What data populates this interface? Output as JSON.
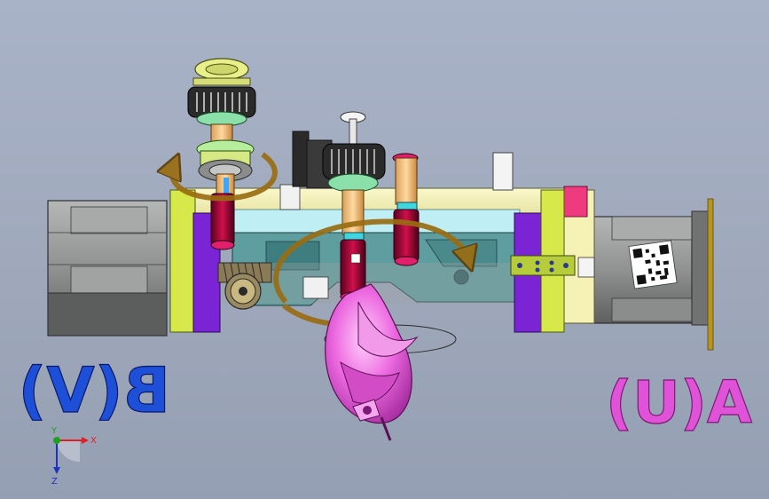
{
  "labels": {
    "left_label": "B(V)",
    "right_label": "A(U)"
  },
  "triad": {
    "x_label": "X",
    "y_label": "Y",
    "z_label": "Z"
  },
  "colors": {
    "background": "#a3adc1",
    "motor_gray": "#8e9190",
    "frame_lime": "#d6e84a",
    "violet_plate": "#7a24d6",
    "cream_housing": "#f4f1b8",
    "rotation_arrow": "#9a6d12",
    "pink_part": "#e458d8",
    "magenta_cap": "#c0125a",
    "teal_bracket": "#5f9ea0",
    "label_blue": "#1d4fd8",
    "label_pink": "#e052d8"
  }
}
